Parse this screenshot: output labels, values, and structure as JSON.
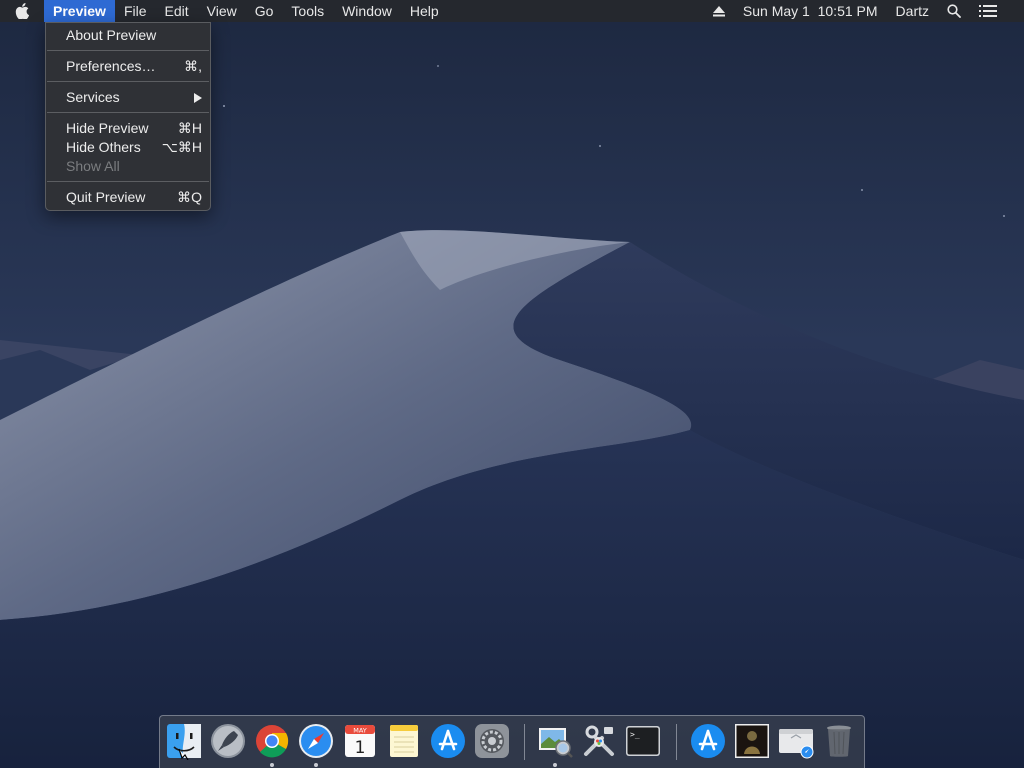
{
  "menubar": {
    "app_name": "Preview",
    "menus": [
      "File",
      "Edit",
      "View",
      "Go",
      "Tools",
      "Window",
      "Help"
    ],
    "status": {
      "datetime": "Sun May 1  10:51 PM",
      "user": "Dartz"
    }
  },
  "app_menu": {
    "about": "About Preview",
    "preferences": {
      "label": "Preferences…",
      "shortcut": "⌘,"
    },
    "services": "Services",
    "hide": {
      "label": "Hide Preview",
      "shortcut": "⌘H"
    },
    "hide_others": {
      "label": "Hide Others",
      "shortcut": "⌥⌘H"
    },
    "show_all": "Show All",
    "quit": {
      "label": "Quit Preview",
      "shortcut": "⌘Q"
    }
  },
  "dock": {
    "calendar_month": "MAY",
    "calendar_day": "1",
    "terminal_prompt": ">_"
  },
  "colors": {
    "menu_highlight": "#2e6ad3",
    "menubar_bg": "#26282c",
    "menu_bg": "#303236"
  }
}
